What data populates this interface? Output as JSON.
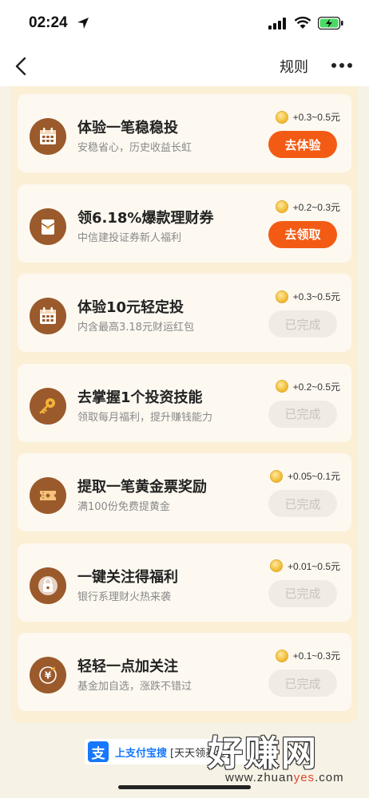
{
  "status_bar": {
    "time": "02:24"
  },
  "nav": {
    "rules_label": "规则"
  },
  "tasks": [
    {
      "title": "体验一笔稳稳投",
      "desc": "安稳省心，历史收益长虹",
      "reward": "+0.3~0.5元",
      "action": "去体验",
      "state": "active",
      "icon": "calendar-icon"
    },
    {
      "title": "领6.18%爆款理财券",
      "desc": "中信建投证券新人福利",
      "reward": "+0.2~0.3元",
      "action": "去领取",
      "state": "active",
      "icon": "envelope-icon"
    },
    {
      "title": "体验10元轻定投",
      "desc": "内含最高3.18元财运红包",
      "reward": "+0.3~0.5元",
      "action": "已完成",
      "state": "done",
      "icon": "calendar-icon"
    },
    {
      "title": "去掌握1个投资技能",
      "desc": "领取每月福利，提升赚钱能力",
      "reward": "+0.2~0.5元",
      "action": "已完成",
      "state": "done",
      "icon": "key-icon"
    },
    {
      "title": "提取一笔黄金票奖励",
      "desc": "满100份免费提黄金",
      "reward": "+0.05~0.1元",
      "action": "已完成",
      "state": "done",
      "icon": "ticket-icon"
    },
    {
      "title": "一键关注得福利",
      "desc": "银行系理财火热来袭",
      "reward": "+0.01~0.5元",
      "action": "已完成",
      "state": "done",
      "icon": "bag-icon"
    },
    {
      "title": "轻轻一点加关注",
      "desc": "基金加自选，涨跌不错过",
      "reward": "+0.1~0.3元",
      "action": "已完成",
      "state": "done",
      "icon": "fund-icon"
    }
  ],
  "footer": {
    "logo_char": "支",
    "search_label": "上支付宝搜",
    "keyword": "[天天领基金]"
  },
  "watermark": {
    "brand": "好赚网",
    "url_prefix": "www.zhuan",
    "url_highlight": "yes",
    "url_suffix": ".com"
  },
  "colors": {
    "accent": "#f35b14",
    "icon_bg": "#9b5a2c",
    "panel_bg": "#fbefd6",
    "done_btn_bg": "#f0ece5"
  }
}
